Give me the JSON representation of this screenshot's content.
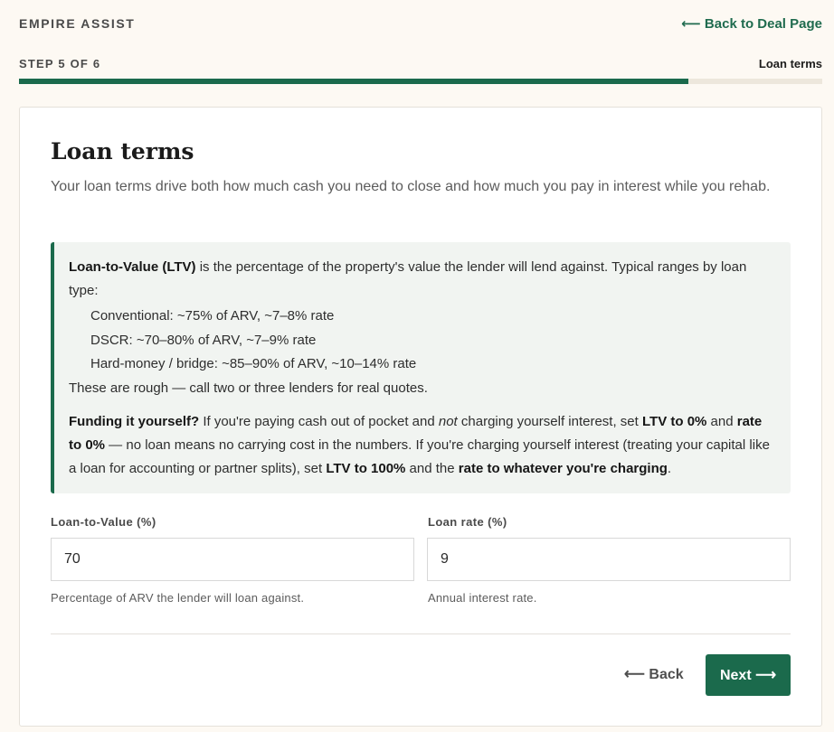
{
  "header": {
    "brand": "EMPIRE ASSIST",
    "back_link": "⟵ Back to Deal Page"
  },
  "progress": {
    "step_label": "STEP 5 OF 6",
    "step_name": "Loan terms",
    "current_step": 5,
    "total_steps": 6,
    "accent_color": "#1b6a4c"
  },
  "card": {
    "title": "Loan terms",
    "subtitle": "Your loan terms drive both how much cash you need to close and how much you pay in interest while you rehab.",
    "info": {
      "ltv_term": "Loan-to-Value (LTV)",
      "ltv_desc": " is the percentage of the property's value the lender will lend against. Typical ranges by loan type:",
      "ranges": [
        "Conventional: ~75% of ARV, ~7–8% rate",
        "DSCR: ~70–80% of ARV, ~7–9% rate",
        "Hard-money / bridge: ~85–90% of ARV, ~10–14% rate"
      ],
      "rough_note": "These are rough — call two or three lenders for real quotes.",
      "self_fund_heading": "Funding it yourself?",
      "self_fund_1": " If you're paying cash out of pocket and ",
      "self_fund_not": "not",
      "self_fund_2": " charging yourself interest, set ",
      "ltv_zero": "LTV to 0%",
      "self_fund_3": " and ",
      "rate_zero": "rate to 0%",
      "self_fund_4": " — no loan means no carrying cost in the numbers. If you're charging yourself interest (treating your capital like a loan for accounting or partner splits), set ",
      "ltv_hundred": "LTV to 100%",
      "self_fund_5": " and the ",
      "rate_charging": "rate to whatever you're charging",
      "self_fund_6": "."
    },
    "fields": {
      "ltv": {
        "label": "Loan-to-Value (%)",
        "value": "70",
        "help": "Percentage of ARV the lender will loan against."
      },
      "rate": {
        "label": "Loan rate (%)",
        "value": "9",
        "help": "Annual interest rate."
      }
    },
    "actions": {
      "back": "⟵ Back",
      "next": "Next ⟶"
    }
  }
}
